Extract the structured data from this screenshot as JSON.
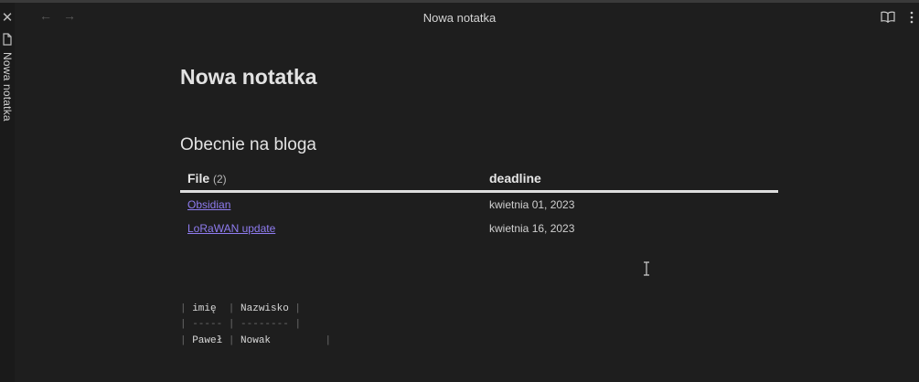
{
  "window": {
    "title": "Nowa notatka"
  },
  "sidebar": {
    "tab_label": "Nowa notatka"
  },
  "icons": {
    "close": "close-icon",
    "file": "file-icon",
    "back": "arrow-left-icon",
    "forward": "arrow-right-icon",
    "reading": "book-open-icon",
    "more": "more-vertical-icon"
  },
  "note": {
    "title": "Nowa notatka",
    "section_heading": "Obecnie na bloga",
    "table": {
      "col_file": "File",
      "count": "(2)",
      "col_deadline": "deadline",
      "rows": [
        {
          "file": "Obsidian",
          "deadline": "kwietnia 01, 2023"
        },
        {
          "file": "LoRaWAN update",
          "deadline": "kwietnia 16, 2023"
        }
      ]
    },
    "raw_table": {
      "header1": "imię",
      "header2": "Nazwisko",
      "sep1": "-----",
      "sep2": "--------",
      "cell1": "Paweł",
      "cell2": "Nowak"
    }
  },
  "colors": {
    "background": "#1e1e1e",
    "link": "#8f7cf0",
    "text": "#dcddde"
  }
}
